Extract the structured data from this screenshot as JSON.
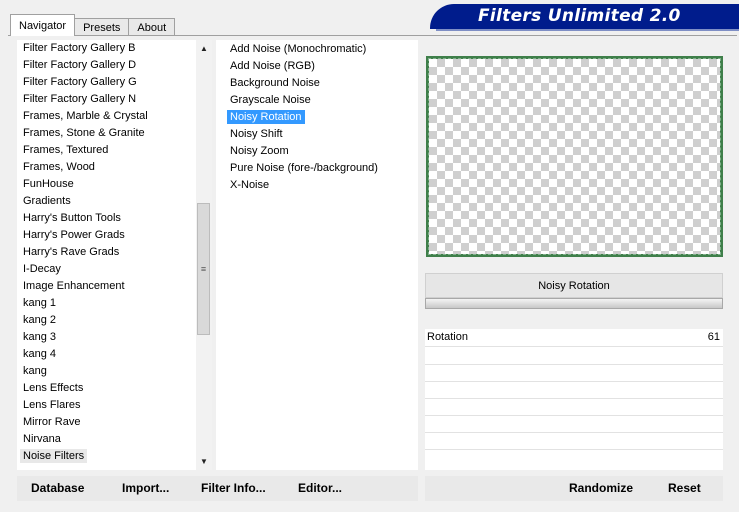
{
  "tabs": [
    "Navigator",
    "Presets",
    "About"
  ],
  "title": "Filters Unlimited 2.0",
  "categories": [
    "Filter Factory Gallery B",
    "Filter Factory Gallery D",
    "Filter Factory Gallery G",
    "Filter Factory Gallery N",
    "Frames, Marble & Crystal",
    "Frames, Stone & Granite",
    "Frames, Textured",
    "Frames, Wood",
    "FunHouse",
    "Gradients",
    "Harry's Button Tools",
    "Harry's Power Grads",
    "Harry's Rave Grads",
    "I-Decay",
    "Image Enhancement",
    "kang 1",
    "kang 2",
    "kang 3",
    "kang 4",
    "kang",
    "Lens Effects",
    "Lens Flares",
    "Mirror Rave",
    "Nirvana",
    "Noise Filters"
  ],
  "selected_category": "Noise Filters",
  "filters": [
    "Add Noise (Monochromatic)",
    "Add Noise (RGB)",
    "Background Noise",
    "Grayscale Noise",
    "Noisy Rotation",
    "Noisy Shift",
    "Noisy Zoom",
    "Pure Noise (fore-/background)",
    "X-Noise"
  ],
  "selected_filter": "Noisy Rotation",
  "filter_title": "Noisy Rotation",
  "params": [
    {
      "name": "Rotation",
      "value": "61"
    }
  ],
  "buttons": {
    "database": "Database",
    "import": "Import...",
    "filter_info": "Filter Info...",
    "editor": "Editor...",
    "randomize": "Randomize",
    "reset": "Reset"
  },
  "colors": {
    "banner": "#001c8c",
    "selection": "#3399ff",
    "preview_frame": "#3f7f4a"
  }
}
